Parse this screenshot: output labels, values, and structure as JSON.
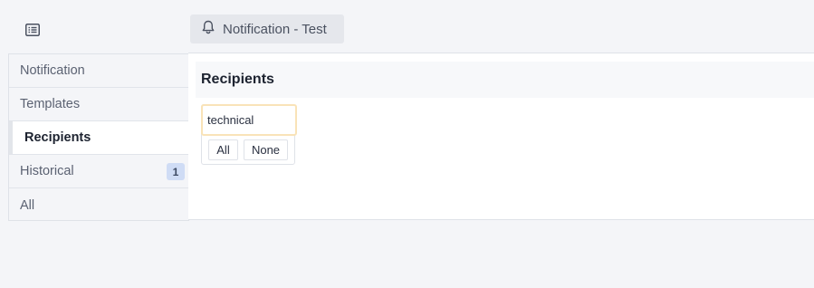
{
  "header": {
    "toggle_icon": "list-icon",
    "title_icon": "bell-icon",
    "title": "Notification - Test"
  },
  "sidebar": {
    "items": [
      {
        "label": "Notification"
      },
      {
        "label": "Templates"
      },
      {
        "label": "Recipients",
        "active": true
      },
      {
        "label": "Historical",
        "badge": "1"
      },
      {
        "label": "All"
      }
    ]
  },
  "main": {
    "section_title": "Recipients",
    "recipient_option": "technical",
    "select_all_label": "All",
    "select_none_label": "None"
  },
  "colors": {
    "background": "#f4f5f8",
    "badge": "#cfdcf5",
    "focus_outline": "#f9e3b8"
  }
}
